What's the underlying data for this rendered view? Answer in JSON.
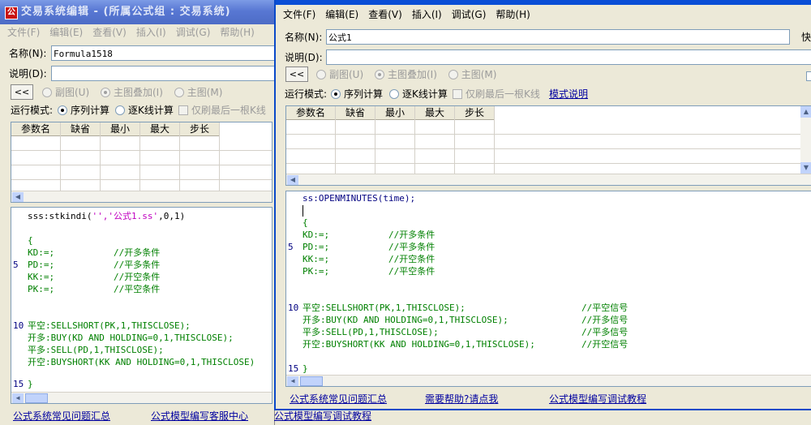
{
  "w1": {
    "title": "交易系统编辑 - (所属公式组 : 交易系统)",
    "menu": [
      "文件(F)",
      "编辑(E)",
      "查看(V)",
      "插入(I)",
      "调试(G)",
      "帮助(H)"
    ],
    "name_label": "名称(N):",
    "name_value": "Formula1518",
    "desc_label": "说明(D):",
    "collapse": "<<",
    "chart_opts": [
      "副图(U)",
      "主图叠加(I)",
      "主图(M)"
    ],
    "run_mode_label": "运行模式:",
    "run_opts": [
      "序列计算",
      "逐K线计算"
    ],
    "last_only": "仅刷最后一根K线",
    "param_cols": [
      "参数名",
      "缺省",
      "最小",
      "最大",
      "步长"
    ],
    "code": [
      {
        "text": "sss:stkindi(",
        "str": "'','公式1.ss'",
        "tail": ",0,1)"
      },
      {
        "text": "{"
      },
      {
        "text": "KD:=;",
        "comment": "//开多条件"
      },
      {
        "text": "PD:=;",
        "comment": "//平多条件"
      },
      {
        "text": "KK:=;",
        "comment": "//开空条件"
      },
      {
        "text": "PK:=;",
        "comment": "//平空条件"
      },
      {
        "text": "平空:SELLSHORT(PK,1,THISCLOSE);"
      },
      {
        "text": "开多:BUY(KD AND HOLDING=0,1,THISCLOSE);"
      },
      {
        "text": "平多:SELL(PD,1,THISCLOSE);"
      },
      {
        "text": "开空:BUYSHORT(KK AND HOLDING=0,1,THISCLOSE)"
      },
      {
        "text": "}"
      }
    ],
    "line_numbers": [
      "5",
      "10",
      "15"
    ],
    "links": [
      "公式系统常见问题汇总",
      "公式模型编写客服中心",
      "公式模型编写调试教程"
    ]
  },
  "w2": {
    "menu": [
      "文件(F)",
      "编辑(E)",
      "查看(V)",
      "插入(I)",
      "调试(G)",
      "帮助(H)"
    ],
    "name_label": "名称(N):",
    "name_value": "公式1",
    "fast_label": "快",
    "desc_label": "说明(D):",
    "collapse": "<<",
    "chart_opts": [
      "副图(U)",
      "主图叠加(I)",
      "主图(M)"
    ],
    "run_mode_label": "运行模式:",
    "run_opts": [
      "序列计算",
      "逐K线计算"
    ],
    "last_only": "仅刷最后一根K线",
    "model_desc_link": "模式说明",
    "param_cols": [
      "参数名",
      "缺省",
      "最小",
      "最大",
      "步长"
    ],
    "code_first": "ss:OPENMINUTES(time);",
    "code": [
      {
        "text": "{"
      },
      {
        "text": "KD:=;",
        "comment": "//开多条件"
      },
      {
        "text": "PD:=;",
        "comment": "//平多条件"
      },
      {
        "text": "KK:=;",
        "comment": "//开空条件"
      },
      {
        "text": "PK:=;",
        "comment": "//平空条件"
      },
      {
        "text": "平空:SELLSHORT(PK,1,THISCLOSE);",
        "comment": "//平空信号"
      },
      {
        "text": "开多:BUY(KD AND HOLDING=0,1,THISCLOSE);",
        "comment": "//开多信号"
      },
      {
        "text": "平多:SELL(PD,1,THISCLOSE);",
        "comment": "//平多信号"
      },
      {
        "text": "开空:BUYSHORT(KK AND HOLDING=0,1,THISCLOSE);",
        "comment": "//开空信号"
      },
      {
        "text": "}"
      }
    ],
    "line_numbers": [
      "5",
      "10",
      "15"
    ],
    "links": [
      "公式系统常见问题汇总",
      "需要帮助?请点我",
      "公式模型编写调试教程"
    ]
  },
  "colors": {
    "active_title": "#0a4ed6",
    "inactive_title": "#5877d3",
    "link": "#0000a0",
    "comment": "#008000",
    "string": "#c000c0"
  }
}
